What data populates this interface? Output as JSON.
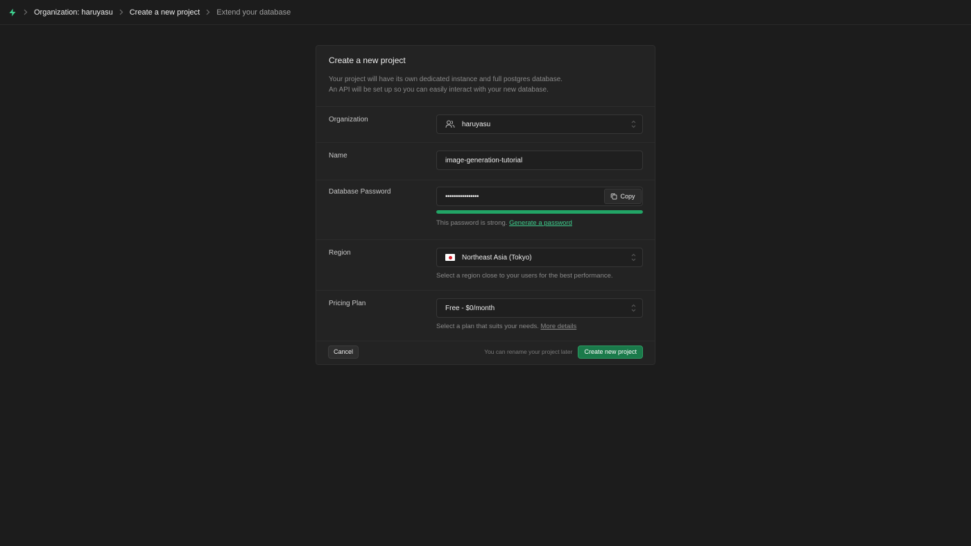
{
  "breadcrumb": {
    "items": [
      "Organization: haruyasu",
      "Create a new project",
      "Extend your database"
    ]
  },
  "card": {
    "title": "Create a new project",
    "desc_line1": "Your project will have its own dedicated instance and full postgres database.",
    "desc_line2": "An API will be set up so you can easily interact with your new database."
  },
  "org": {
    "label": "Organization",
    "value": "haruyasu"
  },
  "name": {
    "label": "Name",
    "value": "image-generation-tutorial"
  },
  "password": {
    "label": "Database Password",
    "value": "••••••••••••••••",
    "copy_label": "Copy",
    "strength_fraction": 1.0,
    "hint_text": "This password is strong.",
    "hint_link": "Generate a password"
  },
  "region": {
    "label": "Region",
    "value": "Northeast Asia (Tokyo)",
    "hint": "Select a region close to your users for the best performance."
  },
  "plan": {
    "label": "Pricing Plan",
    "value": "Free - $0/month",
    "hint_text": "Select a plan that suits your needs.",
    "hint_link": "More details"
  },
  "footer": {
    "cancel_label": "Cancel",
    "note": "You can rename your project later",
    "create_label": "Create new project"
  },
  "colors": {
    "accent": "#3ecf8e",
    "button_green": "#1a7a4a",
    "strength_green": "#22a566",
    "background": "#1c1c1c"
  }
}
